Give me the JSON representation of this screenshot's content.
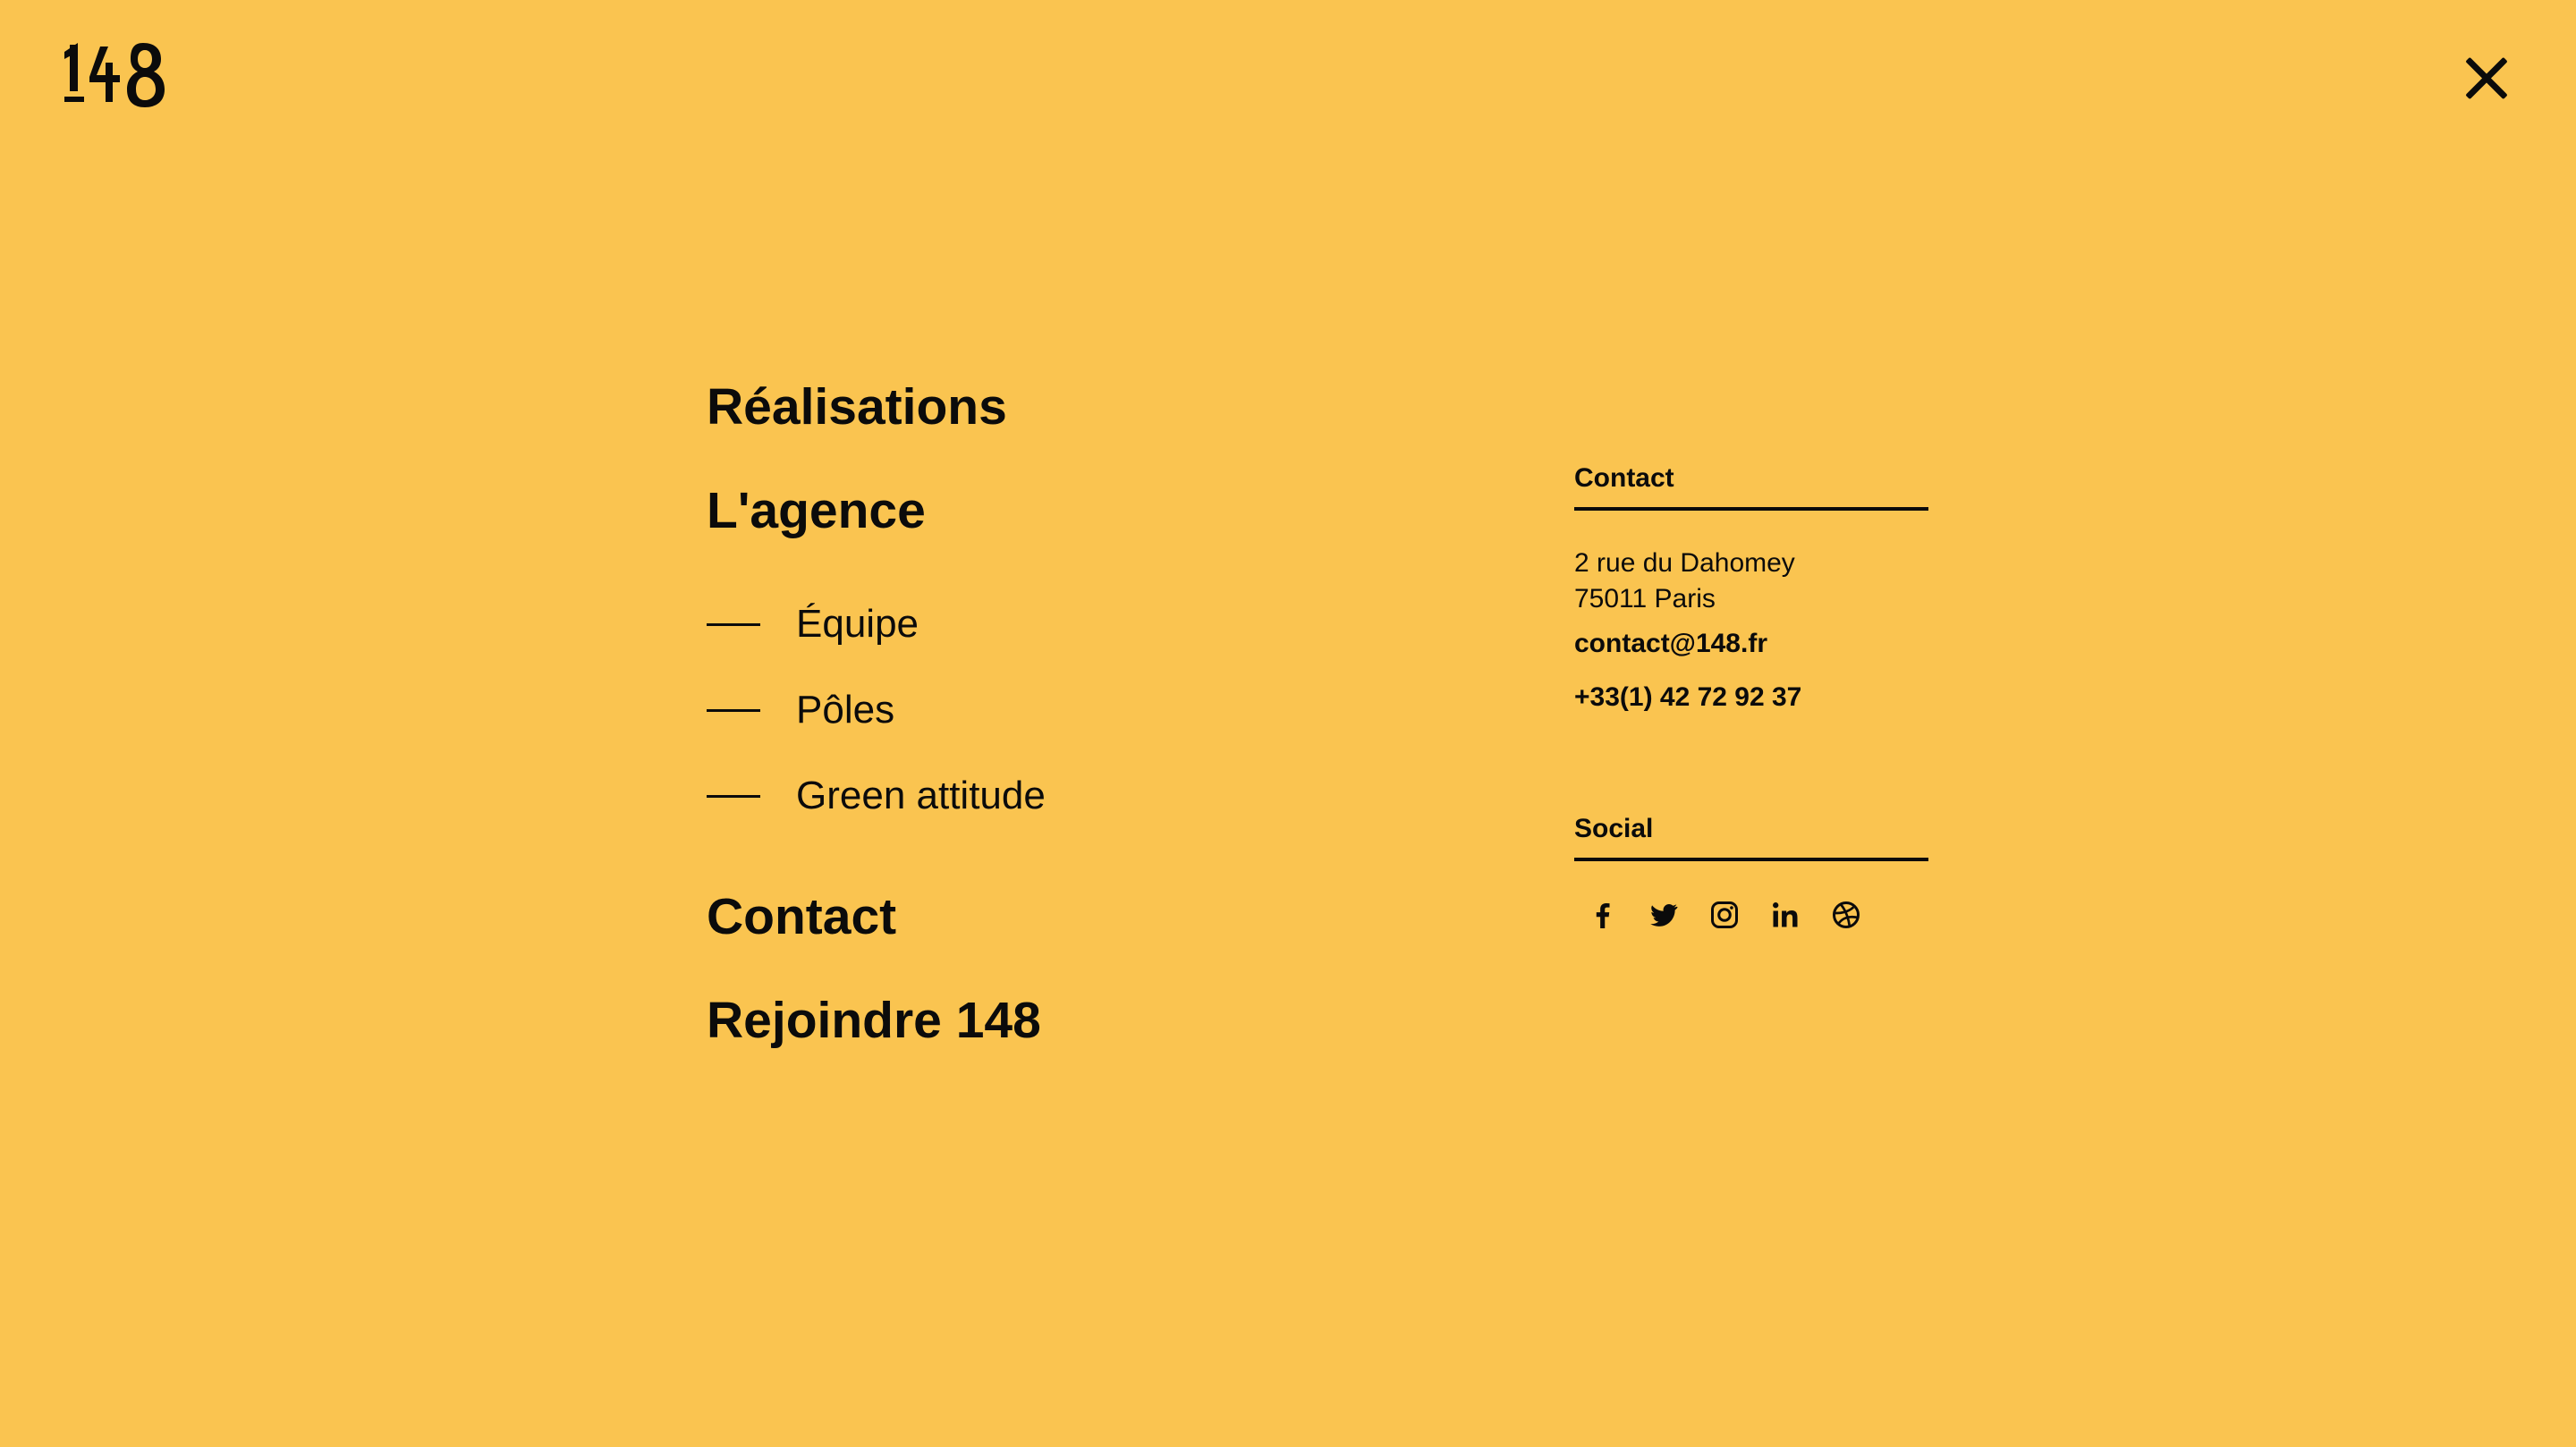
{
  "header": {
    "logo_text": "148",
    "close_icon": "close-icon"
  },
  "menu": {
    "realisations": "Réalisations",
    "agence": "L'agence",
    "sub_items": [
      {
        "label": "Équipe"
      },
      {
        "label": "Pôles"
      },
      {
        "label": "Green attitude"
      }
    ],
    "contact": "Contact",
    "rejoindre": "Rejoindre 148"
  },
  "sidebar": {
    "contact_heading": "Contact",
    "address_line1": "2 rue du Dahomey",
    "address_line2": "75011 Paris",
    "email": "contact@148.fr",
    "phone": "+33(1) 42 72 92 37",
    "social_heading": "Social",
    "social_icons": [
      "facebook-icon",
      "twitter-icon",
      "instagram-icon",
      "linkedin-icon",
      "dribbble-icon"
    ]
  },
  "colors": {
    "background": "#FAC450",
    "text": "#0b0b0b"
  }
}
